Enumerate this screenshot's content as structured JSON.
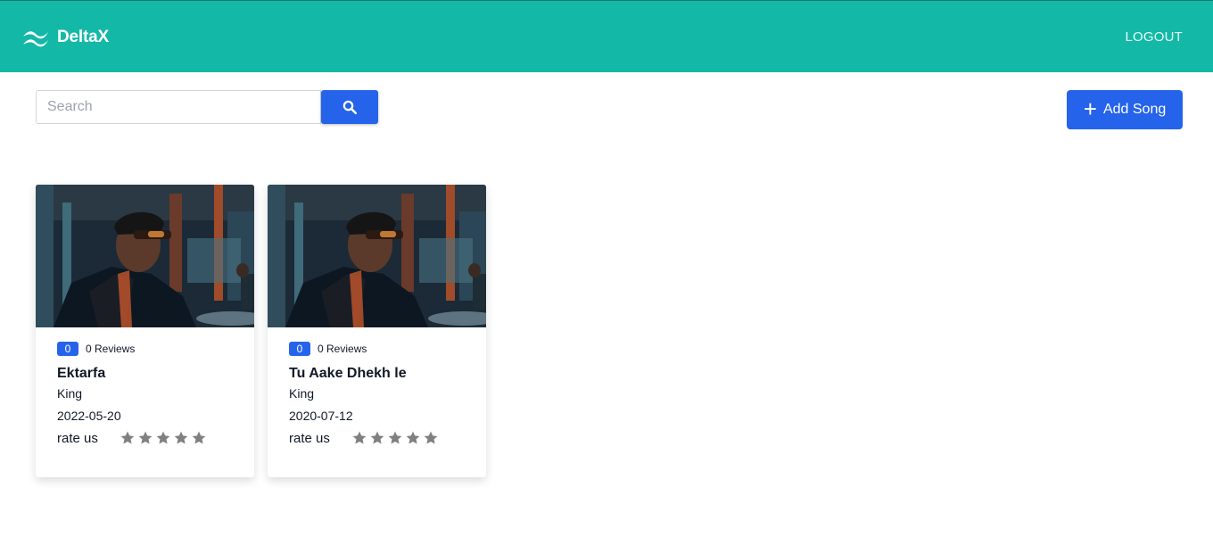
{
  "navbar": {
    "brand": "DeltaX",
    "logout_label": "LOGOUT",
    "color": "#14b8a6"
  },
  "search": {
    "placeholder": "Search",
    "value": "",
    "button_icon": "search-icon"
  },
  "add_song": {
    "label": "Add Song",
    "icon": "plus-icon"
  },
  "accent_color": "#2563eb",
  "songs": [
    {
      "review_count": "0",
      "reviews_label": "0 Reviews",
      "title": "Ektarfa",
      "artist": "King",
      "date": "2022-05-20",
      "rate_label": "rate us",
      "rating": 0,
      "max_rating": 5
    },
    {
      "review_count": "0",
      "reviews_label": "0 Reviews",
      "title": "Tu Aake Dhekh le",
      "artist": "King",
      "date": "2020-07-12",
      "rate_label": "rate us",
      "rating": 0,
      "max_rating": 5
    }
  ]
}
